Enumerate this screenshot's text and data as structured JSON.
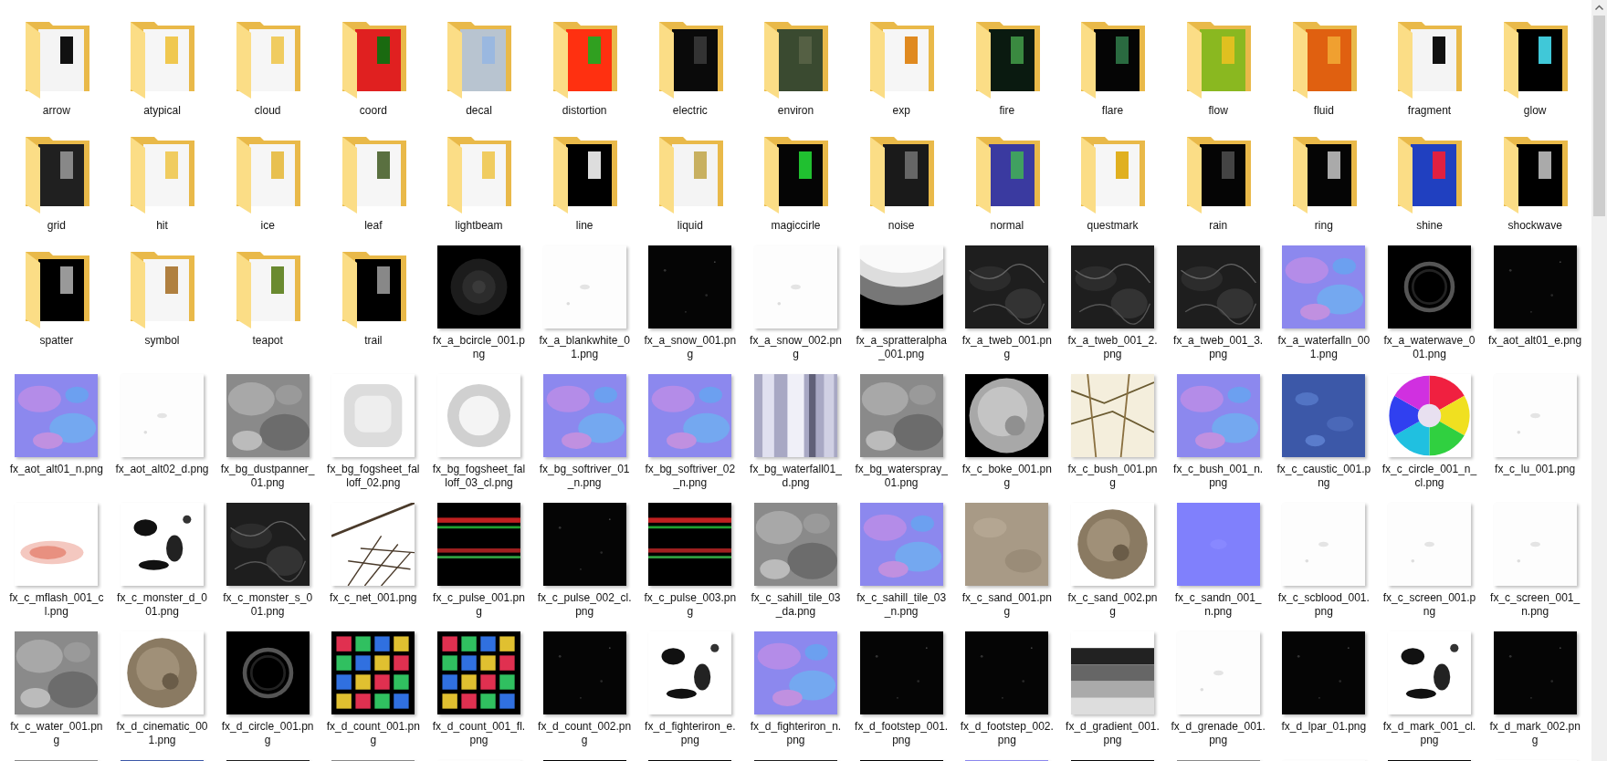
{
  "items": [
    {
      "kind": "folder",
      "name": "arrow"
    },
    {
      "kind": "folder",
      "name": "atypical"
    },
    {
      "kind": "folder",
      "name": "cloud"
    },
    {
      "kind": "folder",
      "name": "coord"
    },
    {
      "kind": "folder",
      "name": "decal"
    },
    {
      "kind": "folder",
      "name": "distortion"
    },
    {
      "kind": "folder",
      "name": "electric"
    },
    {
      "kind": "folder",
      "name": "environ"
    },
    {
      "kind": "folder",
      "name": "exp"
    },
    {
      "kind": "folder",
      "name": "fire"
    },
    {
      "kind": "folder",
      "name": "flare"
    },
    {
      "kind": "folder",
      "name": "flow"
    },
    {
      "kind": "folder",
      "name": "fluid"
    },
    {
      "kind": "folder",
      "name": "fragment"
    },
    {
      "kind": "folder",
      "name": "glow"
    },
    {
      "kind": "folder",
      "name": "grid"
    },
    {
      "kind": "folder",
      "name": "hit"
    },
    {
      "kind": "folder",
      "name": "ice"
    },
    {
      "kind": "folder",
      "name": "leaf"
    },
    {
      "kind": "folder",
      "name": "lightbeam"
    },
    {
      "kind": "folder",
      "name": "line"
    },
    {
      "kind": "folder",
      "name": "liquid"
    },
    {
      "kind": "folder",
      "name": "magiccirle"
    },
    {
      "kind": "folder",
      "name": "noise"
    },
    {
      "kind": "folder",
      "name": "normal"
    },
    {
      "kind": "folder",
      "name": "questmark"
    },
    {
      "kind": "folder",
      "name": "rain"
    },
    {
      "kind": "folder",
      "name": "ring"
    },
    {
      "kind": "folder",
      "name": "shine"
    },
    {
      "kind": "folder",
      "name": "shockwave"
    },
    {
      "kind": "folder",
      "name": "spatter"
    },
    {
      "kind": "folder",
      "name": "symbol"
    },
    {
      "kind": "folder",
      "name": "teapot"
    },
    {
      "kind": "folder",
      "name": "trail"
    },
    {
      "name": "fx_a_bcircle_001.png"
    },
    {
      "name": "fx_a_blankwhite_01.png"
    },
    {
      "name": "fx_a_snow_001.png"
    },
    {
      "name": "fx_a_snow_002.png"
    },
    {
      "name": "fx_a_spratteralpha_001.png"
    },
    {
      "name": "fx_a_tweb_001.png"
    },
    {
      "name": "fx_a_tweb_001_2.png"
    },
    {
      "name": "fx_a_tweb_001_3.png"
    },
    {
      "name": "fx_a_waterfalln_001.png"
    },
    {
      "name": "fx_a_waterwave_001.png"
    },
    {
      "name": "fx_aot_alt01_e.png"
    },
    {
      "name": "fx_aot_alt01_n.png"
    },
    {
      "name": "fx_aot_alt02_d.png"
    },
    {
      "name": "fx_bg_dustpanner_01.png"
    },
    {
      "name": "fx_bg_fogsheet_falloff_02.png"
    },
    {
      "name": "fx_bg_fogsheet_falloff_03_cl.png"
    },
    {
      "name": "fx_bg_softriver_01_n.png"
    },
    {
      "name": "fx_bg_softriver_02_n.png"
    },
    {
      "name": "fx_bg_waterfall01_d.png"
    },
    {
      "name": "fx_bg_waterspray_01.png"
    },
    {
      "name": "fx_c_boke_001.png"
    },
    {
      "name": "fx_c_bush_001.png"
    },
    {
      "name": "fx_c_bush_001_n.png"
    },
    {
      "name": "fx_c_caustic_001.png"
    },
    {
      "name": "fx_c_circle_001_n_cl.png"
    },
    {
      "name": "fx_c_lu_001.png"
    },
    {
      "name": "fx_c_mflash_001_cl.png"
    },
    {
      "name": "fx_c_monster_d_001.png"
    },
    {
      "name": "fx_c_monster_s_001.png"
    },
    {
      "name": "fx_c_net_001.png"
    },
    {
      "name": "fx_c_pulse_001.png"
    },
    {
      "name": "fx_c_pulse_002_cl.png"
    },
    {
      "name": "fx_c_pulse_003.png"
    },
    {
      "name": "fx_c_sahill_tile_03_da.png"
    },
    {
      "name": "fx_c_sahill_tile_03_n.png"
    },
    {
      "name": "fx_c_sand_001.png"
    },
    {
      "name": "fx_c_sand_002.png"
    },
    {
      "name": "fx_c_sandn_001_n.png"
    },
    {
      "name": "fx_c_scblood_001.png"
    },
    {
      "name": "fx_c_screen_001.png"
    },
    {
      "name": "fx_c_screen_001_n.png"
    },
    {
      "name": "fx_c_water_001.png"
    },
    {
      "name": "fx_d_cinematic_001.png"
    },
    {
      "name": "fx_d_circle_001.png"
    },
    {
      "name": "fx_d_count_001.png"
    },
    {
      "name": "fx_d_count_001_fl.png"
    },
    {
      "name": "fx_d_count_002.png"
    },
    {
      "name": "fx_d_fighteriron_e.png"
    },
    {
      "name": "fx_d_fighteriron_n.png"
    },
    {
      "name": "fx_d_footstep_001.png"
    },
    {
      "name": "fx_d_footstep_002.png"
    },
    {
      "name": "fx_d_gradient_001.png"
    },
    {
      "name": "fx_d_grenade_001.png"
    },
    {
      "name": "fx_d_lpar_01.png"
    },
    {
      "name": "fx_d_mark_001_cl.png"
    },
    {
      "name": "fx_d_mark_002.png"
    },
    {
      "kind": "picture"
    },
    {
      "kind": "picture"
    },
    {
      "kind": "picture"
    },
    {
      "kind": "picture"
    },
    {
      "kind": "picture"
    },
    {
      "kind": "picture"
    },
    {
      "kind": "picture"
    },
    {
      "kind": "picture"
    },
    {
      "kind": "picture"
    },
    {
      "kind": "picture"
    },
    {
      "kind": "picture"
    },
    {
      "kind": "picture"
    },
    {
      "kind": "picture"
    },
    {
      "kind": "picture"
    },
    {
      "kind": "picture"
    }
  ]
}
